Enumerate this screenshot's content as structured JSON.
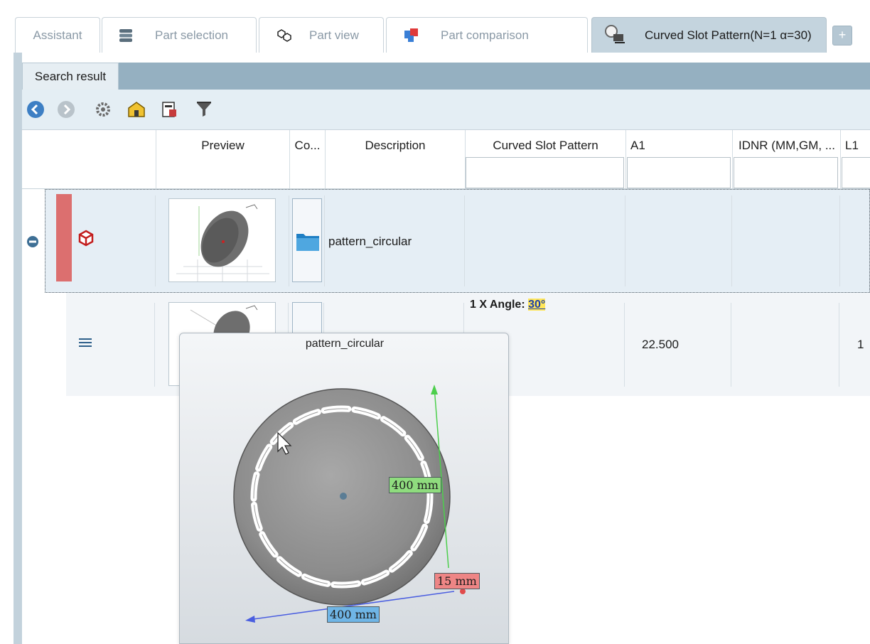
{
  "tabs": [
    {
      "label": "Assistant",
      "icon": "none"
    },
    {
      "label": "Part selection",
      "icon": "stack-icon"
    },
    {
      "label": "Part view",
      "icon": "cubes-icon"
    },
    {
      "label": "Part comparison",
      "icon": "compare-icon"
    },
    {
      "label": "Curved Slot Pattern(N=1 α=30)",
      "icon": "search-part-icon",
      "active": true
    }
  ],
  "tab_add_label": "+",
  "subtab": {
    "label": "Search result"
  },
  "toolbar": {
    "icons": [
      "back-icon",
      "forward-icon",
      "settings-gear-icon",
      "home-folder-icon",
      "export-icon",
      "filter-icon"
    ]
  },
  "table": {
    "columns": [
      "Preview",
      "Co...",
      "Description",
      "Curved Slot Pattern",
      "A1",
      "IDNR (MM,GM, ...",
      "L1"
    ],
    "rows": [
      {
        "type": "folder",
        "description": "pattern_circular"
      },
      {
        "type": "part",
        "curved_slot_pattern_prefix": "1 X Angle:",
        "curved_slot_pattern_value": "30°",
        "a1": "22.500",
        "l1": "1"
      }
    ]
  },
  "popup": {
    "title": "pattern_circular",
    "dimensions": {
      "height": "400 mm",
      "width": "400 mm",
      "thickness": "15 mm"
    }
  },
  "colors": {
    "active_tab": "#c4d4de",
    "header_strip": "#95b0c1",
    "row_selected": "#e5eef5",
    "red_marker": "#dc6f6f",
    "dim_green": "#8fdc7e",
    "dim_blue": "#6fb5e6",
    "dim_red": "#ee8585"
  }
}
